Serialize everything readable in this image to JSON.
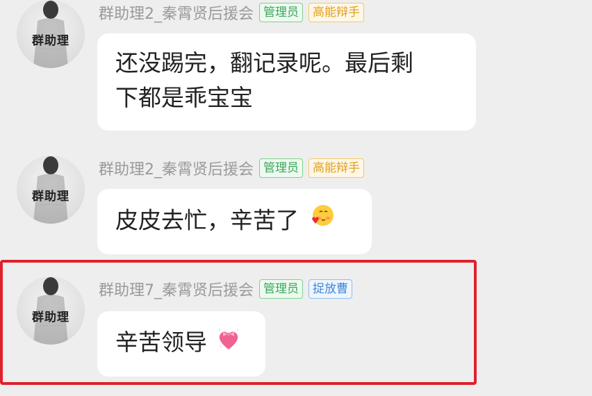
{
  "messages": [
    {
      "avatar_text": "群助理",
      "sender": "群助理2_秦霄贤后援会",
      "badges": [
        "管理员",
        "高能辩手"
      ],
      "text_lines": [
        "还没踢完，翻记录呢。最后剩",
        "下都是乖宝宝"
      ]
    },
    {
      "avatar_text": "群助理",
      "sender": "群助理2_秦霄贤后援会",
      "badges": [
        "管理员",
        "高能辩手"
      ],
      "text": "皮皮去忙，辛苦了",
      "emoji": "blush-heart-emoji"
    },
    {
      "avatar_text": "群助理",
      "sender": "群助理7_秦霄贤后援会",
      "badges": [
        "管理员",
        "捉放曹"
      ],
      "text": "辛苦领导",
      "emoji": "heart-bow-emoji"
    }
  ],
  "colors": {
    "background": "#eeeeee",
    "bubble": "#ffffff",
    "highlight": "#e0202c",
    "admin_badge": "#3aa85a",
    "title_badge_yellow": "#e0a020",
    "title_badge_blue": "#3f86d8"
  }
}
